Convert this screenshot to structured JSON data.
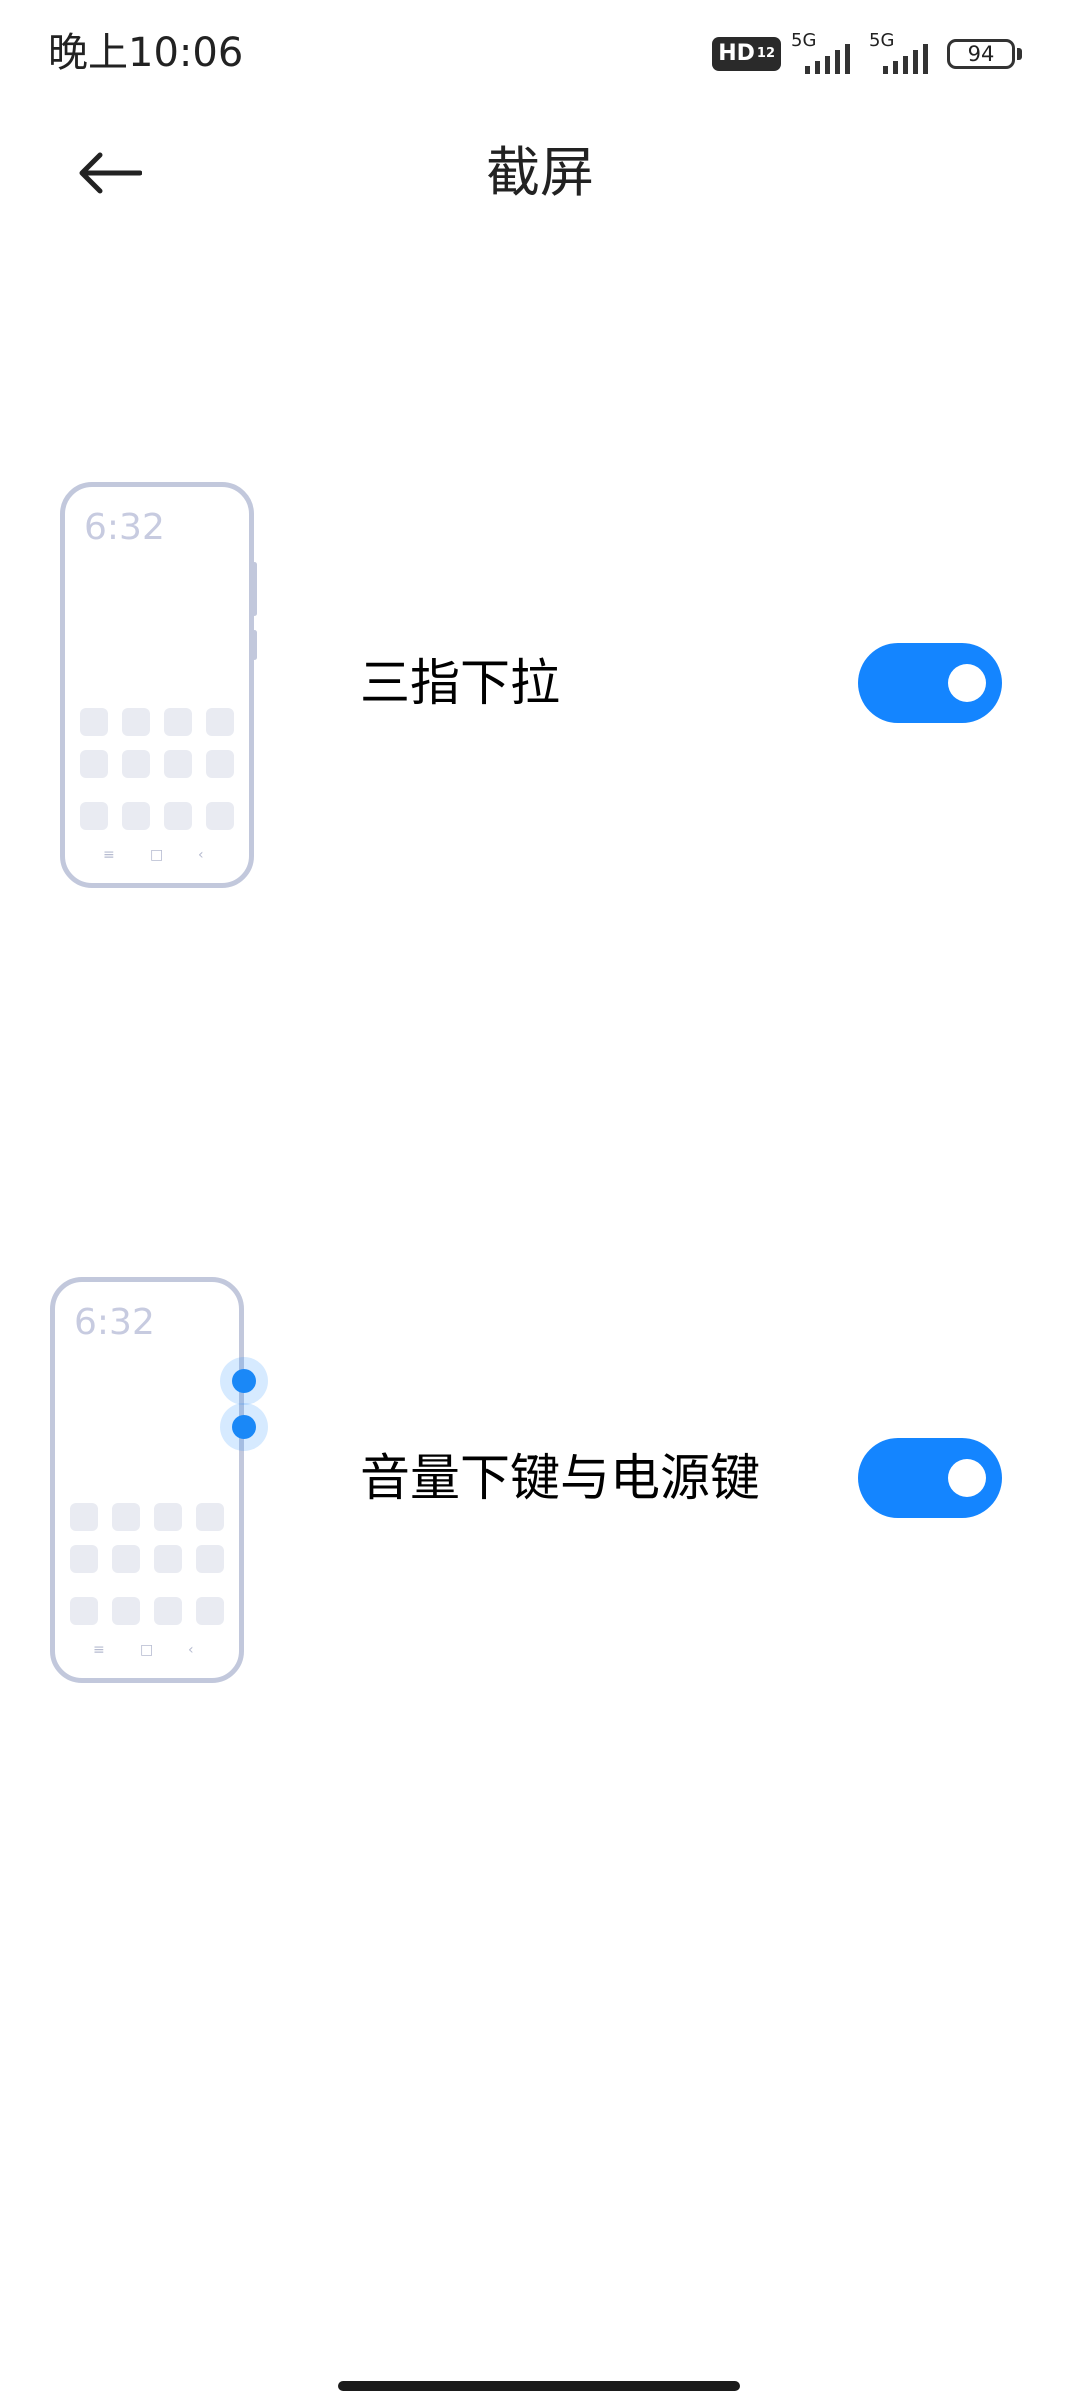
{
  "status_bar": {
    "time": "晚上10:06",
    "hd_label": "HD",
    "hd_sub": "12",
    "sim1_network": "5G",
    "sim2_network": "5G",
    "battery_level": "94",
    "icons": [
      "hd-voice-icon",
      "signal-icon",
      "signal-icon",
      "battery-icon"
    ]
  },
  "header": {
    "back_icon": "arrow-left-icon",
    "title": "截屏"
  },
  "options": [
    {
      "label": "三指下拉",
      "enabled": true,
      "illustration_clock": "6:32",
      "nav_symbols": [
        "≡",
        "□",
        "‹"
      ]
    },
    {
      "label": "音量下键与电源键",
      "enabled": true,
      "illustration_clock": "6:32",
      "nav_symbols": [
        "≡",
        "□",
        "‹"
      ]
    }
  ],
  "colors": {
    "accent": "#1485ff",
    "illustration_stroke": "#c2c8dc",
    "press_dot": "#1a88f7"
  }
}
